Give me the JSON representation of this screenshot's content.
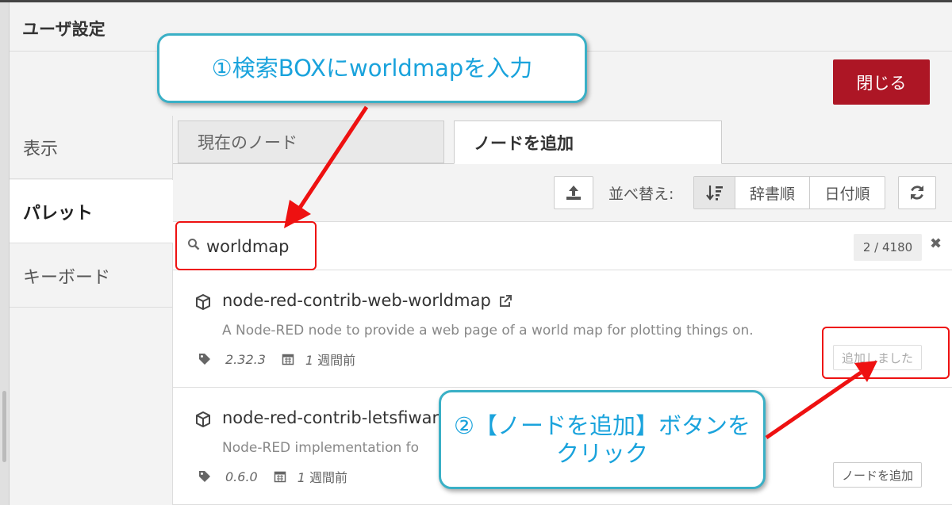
{
  "dialog": {
    "title": "ユーザ設定",
    "close_label": "閉じる"
  },
  "sidebar": {
    "items": [
      {
        "label": "表示"
      },
      {
        "label": "パレット"
      },
      {
        "label": "キーボード"
      }
    ]
  },
  "tabs": [
    {
      "label": "現在のノード"
    },
    {
      "label": "ノードを追加"
    }
  ],
  "toolbar": {
    "upload_icon": "upload-icon",
    "sort_label": "並べ替え:",
    "sort_options": [
      "辞書順",
      "日付順"
    ],
    "sort_selected_icon": "sort-recent-icon",
    "refresh_icon": "refresh-icon"
  },
  "search": {
    "value": "worldmap",
    "count": "2 / 4180",
    "clear": "✖"
  },
  "nodes": [
    {
      "name": "node-red-contrib-web-worldmap",
      "description": "A Node-RED node to provide a web page of a world map for plotting things on.",
      "version": "2.32.3",
      "updated_num": "1",
      "updated_unit": "週間前",
      "button": "追加しました"
    },
    {
      "name": "node-red-contrib-letsfiware",
      "description": "Node-RED implementation fo",
      "version": "0.6.0",
      "updated_num": "1",
      "updated_unit": "週間前",
      "button": "ノードを追加"
    }
  ],
  "annotations": {
    "callout1": "①検索BOXにworldmapを入力",
    "callout2_line1": "②【ノードを追加】ボタンを",
    "callout2_line2": "クリック",
    "color": "#1aa3dc",
    "red": "#ee1111"
  },
  "colors": {
    "close_button": "#ad1625"
  }
}
